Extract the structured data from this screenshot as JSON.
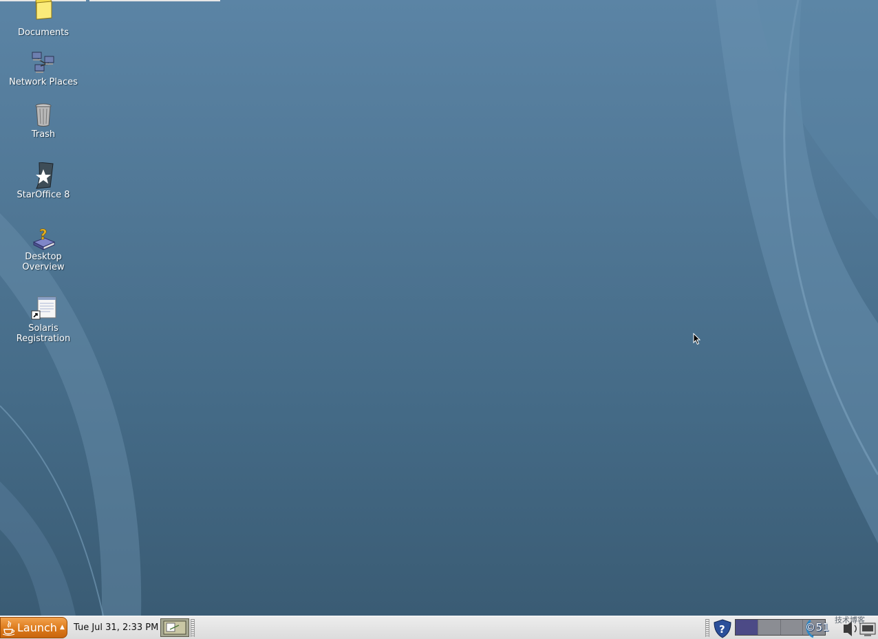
{
  "desktop": {
    "icons": [
      {
        "label": "Documents",
        "icon": "folder-icon"
      },
      {
        "label": "Network Places",
        "icon": "network-icon"
      },
      {
        "label": "Trash",
        "icon": "trash-icon"
      },
      {
        "label": "StarOffice 8",
        "icon": "staroffice-icon"
      },
      {
        "label": "Desktop\nOverview",
        "icon": "help-book-icon"
      },
      {
        "label": "Solaris\nRegistration",
        "icon": "registration-shortcut-icon"
      }
    ]
  },
  "taskbar": {
    "launch_label": "Launch",
    "clock": "Tue Jul 31,  2:33 PM",
    "tray_text": "©51",
    "watermark": "技术博客",
    "workspaces": [
      "1",
      "2",
      "3",
      "4"
    ],
    "active_workspace": 1
  },
  "colors": {
    "desktop_bg": "#4f7694",
    "launch_orange": "#dc7a1c",
    "taskbar_bg": "#e3e3e3",
    "workspace_active": "#4c4a86"
  }
}
